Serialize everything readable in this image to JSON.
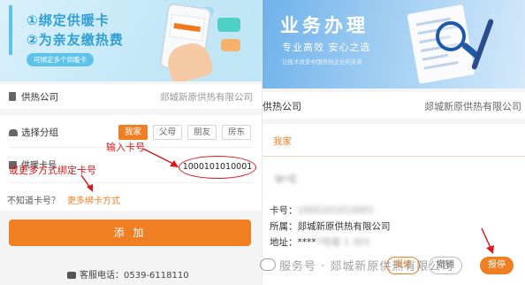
{
  "left": {
    "banner": {
      "line1": "①绑定供暖卡",
      "line2": "②为亲友缴热费",
      "pill": "可绑定多个供暖卡"
    },
    "company": {
      "label": "供热公司",
      "value": "郯城新原供热有限公司"
    },
    "group": {
      "label": "选择分组",
      "options": [
        "我家",
        "父母",
        "朋友",
        "房东"
      ],
      "selected": "我家"
    },
    "card": {
      "label": "供暖卡号",
      "value": "1000101010001"
    },
    "help": {
      "question": "不知道卡号？",
      "link": "更多绑卡方式"
    },
    "add_button": "添 加",
    "service": "客服电话：0539-6118110",
    "annotations": {
      "enter_card": "输入卡号",
      "more_ways": "或更多方式绑定卡号"
    }
  },
  "right": {
    "banner": {
      "title": "业务办理",
      "subtitle": "专业高效  安心之选",
      "slogan": "让技术改变中国供热企业的未来"
    },
    "company": {
      "label": "供热公司",
      "value": "郯城新原供热有限公司"
    },
    "tab": "我家",
    "record": {
      "name_blurred": "徐*花",
      "card_label": "卡号：",
      "card_value": "1000101010001",
      "owner_label": "所属：",
      "owner_value": "郯城新原供热有限公司",
      "address_label": "地址：",
      "address_value_prefix": "****",
      "address_value_blurred": "7号楼 1-301"
    },
    "buttons": [
      "报修",
      "撤销",
      "报停"
    ]
  },
  "watermark": "服务号 · 郯城新原供热有限公司",
  "colors": {
    "accent": "#f07f23",
    "annotation": "#d9191c"
  }
}
